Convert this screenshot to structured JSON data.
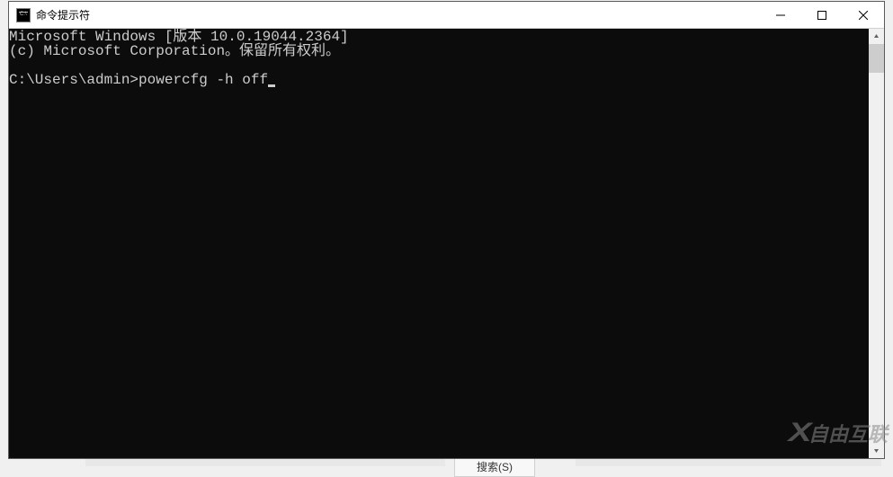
{
  "window": {
    "title": "命令提示符"
  },
  "console": {
    "line1": "Microsoft Windows [版本 10.0.19044.2364]",
    "line2": "(c) Microsoft Corporation。保留所有权利。",
    "blank": "",
    "prompt": "C:\\Users\\admin>",
    "command": "powercfg -h off"
  },
  "watermark": {
    "logo": "X",
    "text": "自由互联"
  },
  "bgmenu": "搜索(S)"
}
